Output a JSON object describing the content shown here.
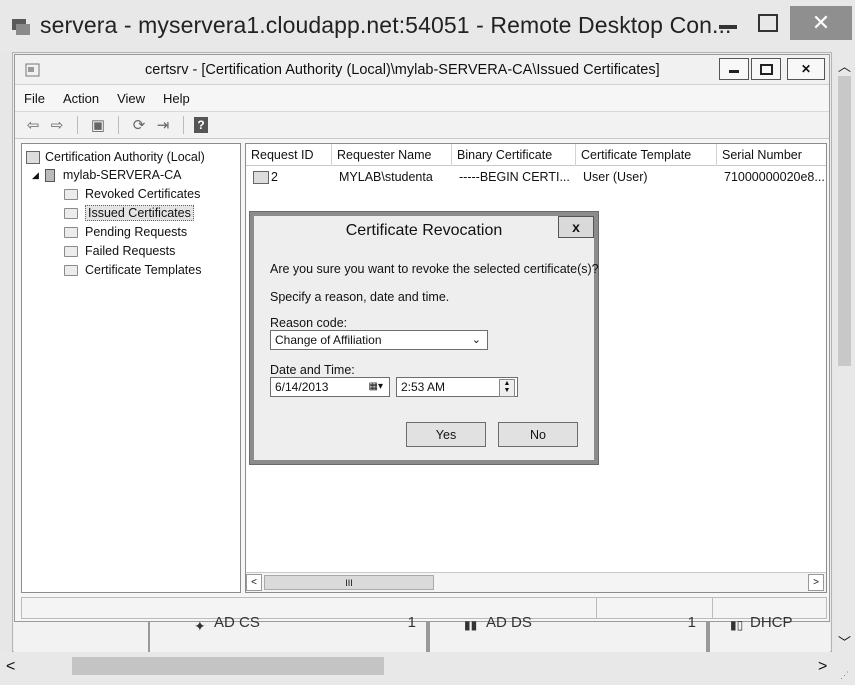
{
  "rdp": {
    "title": "servera - myservera1.cloudapp.net:54051 - Remote Desktop Con...",
    "controls": {
      "min": "—",
      "max": "☐",
      "close": "✕"
    }
  },
  "mmc": {
    "title": "certsrv - [Certification Authority (Local)\\mylab-SERVERA-CA\\Issued Certificates]",
    "controls": {
      "min": "▬",
      "max": "▢",
      "close": "✕"
    },
    "menu": [
      "File",
      "Action",
      "View",
      "Help"
    ]
  },
  "tree": {
    "root": "Certification Authority (Local)",
    "ca": "mylab-SERVERA-CA",
    "items": [
      "Revoked Certificates",
      "Issued Certificates",
      "Pending Requests",
      "Failed Requests",
      "Certificate Templates"
    ],
    "selected_index": 1
  },
  "list": {
    "columns": [
      "Request ID",
      "Requester Name",
      "Binary Certificate",
      "Certificate Template",
      "Serial Number"
    ],
    "rows": [
      {
        "request_id": "2",
        "requester": "MYLAB\\studenta",
        "binary": "-----BEGIN CERTI...",
        "template": "User (User)",
        "serial": "71000000020e8..."
      }
    ],
    "scroll_label": "III"
  },
  "dialog": {
    "title": "Certificate Revocation",
    "close": "x",
    "question": "Are you sure you want to revoke the selected certificate(s)?",
    "instruction": "Specify a reason, date and time.",
    "reason_label": "Reason code:",
    "reason_value": "Change of Affiliation",
    "datetime_label": "Date and Time:",
    "date_value": "6/14/2013",
    "time_value": "2:53 AM",
    "yes": "Yes",
    "no": "No"
  },
  "background_panels": [
    "AD CS",
    "AD DS",
    "DHCP"
  ],
  "background_counts": [
    "1",
    "1"
  ]
}
